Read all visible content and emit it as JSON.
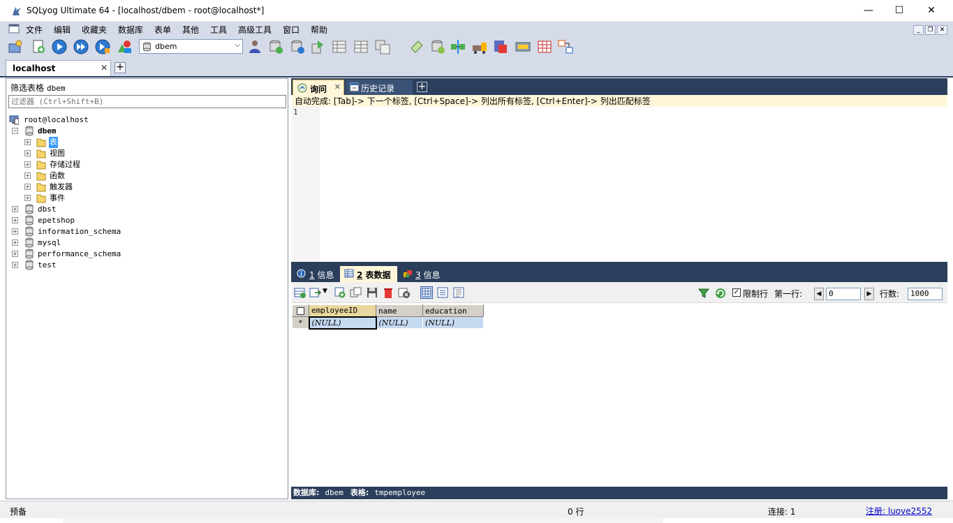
{
  "window": {
    "title": "SQLyog Ultimate 64 - [localhost/dbem - root@localhost*]"
  },
  "menu": [
    "文件",
    "编辑",
    "收藏夹",
    "数据库",
    "表单",
    "其他",
    "工具",
    "高级工具",
    "窗口",
    "帮助"
  ],
  "toolbar": {
    "database_selector_value": "dbem"
  },
  "connection_tab": {
    "label": "localhost"
  },
  "object_browser": {
    "filter_label": "筛选表格",
    "filter_db": "dbem",
    "filter_placeholder": "过滤器 (Ctrl+Shift+B)",
    "root": "root@localhost",
    "current_db": "dbem",
    "folders": [
      "表",
      "视图",
      "存储过程",
      "函数",
      "触发器",
      "事件"
    ],
    "databases": [
      "dbst",
      "epetshop",
      "information_schema",
      "mysql",
      "performance_schema",
      "test"
    ]
  },
  "query_tabs": {
    "query": "询问",
    "history": "历史记录"
  },
  "editor": {
    "autocomplete_hint": "自动完成: [Tab]-> 下一个标签, [Ctrl+Space]-> 列出所有标签, [Ctrl+Enter]-> 列出匹配标签",
    "line_number": "1"
  },
  "result_tabs": [
    {
      "num": "1",
      "label": " 信息"
    },
    {
      "num": "2",
      "label": " 表数据"
    },
    {
      "num": "3",
      "label": " 信息"
    }
  ],
  "result_toolbar": {
    "limit_label": "限制行",
    "first_row_label": "第一行:",
    "first_row_value": "0",
    "rows_label": "行数:",
    "rows_value": "1000"
  },
  "grid": {
    "columns": [
      "employeeID",
      "name",
      "education"
    ],
    "new_row_marker": "*",
    "new_row_values": [
      "(NULL)",
      "(NULL)",
      "(NULL)"
    ]
  },
  "result_status": {
    "db_label": "数据库:",
    "db_value": "dbem",
    "table_label": "表格:",
    "table_value": "tmpemployee"
  },
  "status_bar": {
    "left": "预备",
    "rows": "0 行",
    "connection": "连接: 1",
    "register": "注册: luove2552"
  }
}
